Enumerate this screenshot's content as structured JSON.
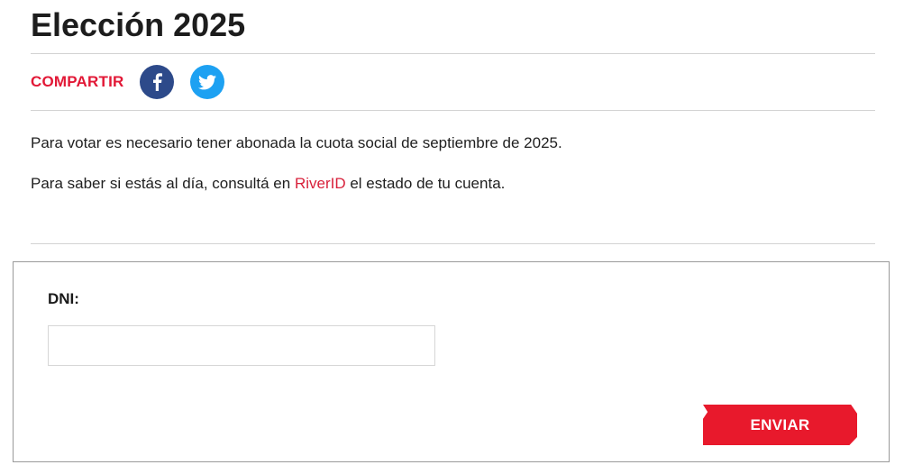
{
  "page": {
    "title": "Elección 2025"
  },
  "share": {
    "label": "COMPARTIR",
    "buttons": [
      {
        "icon": "facebook-icon",
        "color": "#2d4a8a"
      },
      {
        "icon": "twitter-icon",
        "color": "#1da1f2"
      }
    ]
  },
  "content": {
    "paragraph_1": "Para votar es necesario tener abonada la cuota social de septiembre de 2025.",
    "paragraph_2_before": "Para saber si estás al día, consultá en ",
    "paragraph_2_link": "RiverID",
    "paragraph_2_after": " el estado de tu cuenta."
  },
  "form": {
    "dni_label": "DNI:",
    "dni_value": "",
    "submit_label": "ENVIAR"
  },
  "colors": {
    "accent_red": "#e8192c",
    "link_red": "#d8213b",
    "facebook_blue": "#2d4a8a",
    "twitter_blue": "#1da1f2"
  }
}
